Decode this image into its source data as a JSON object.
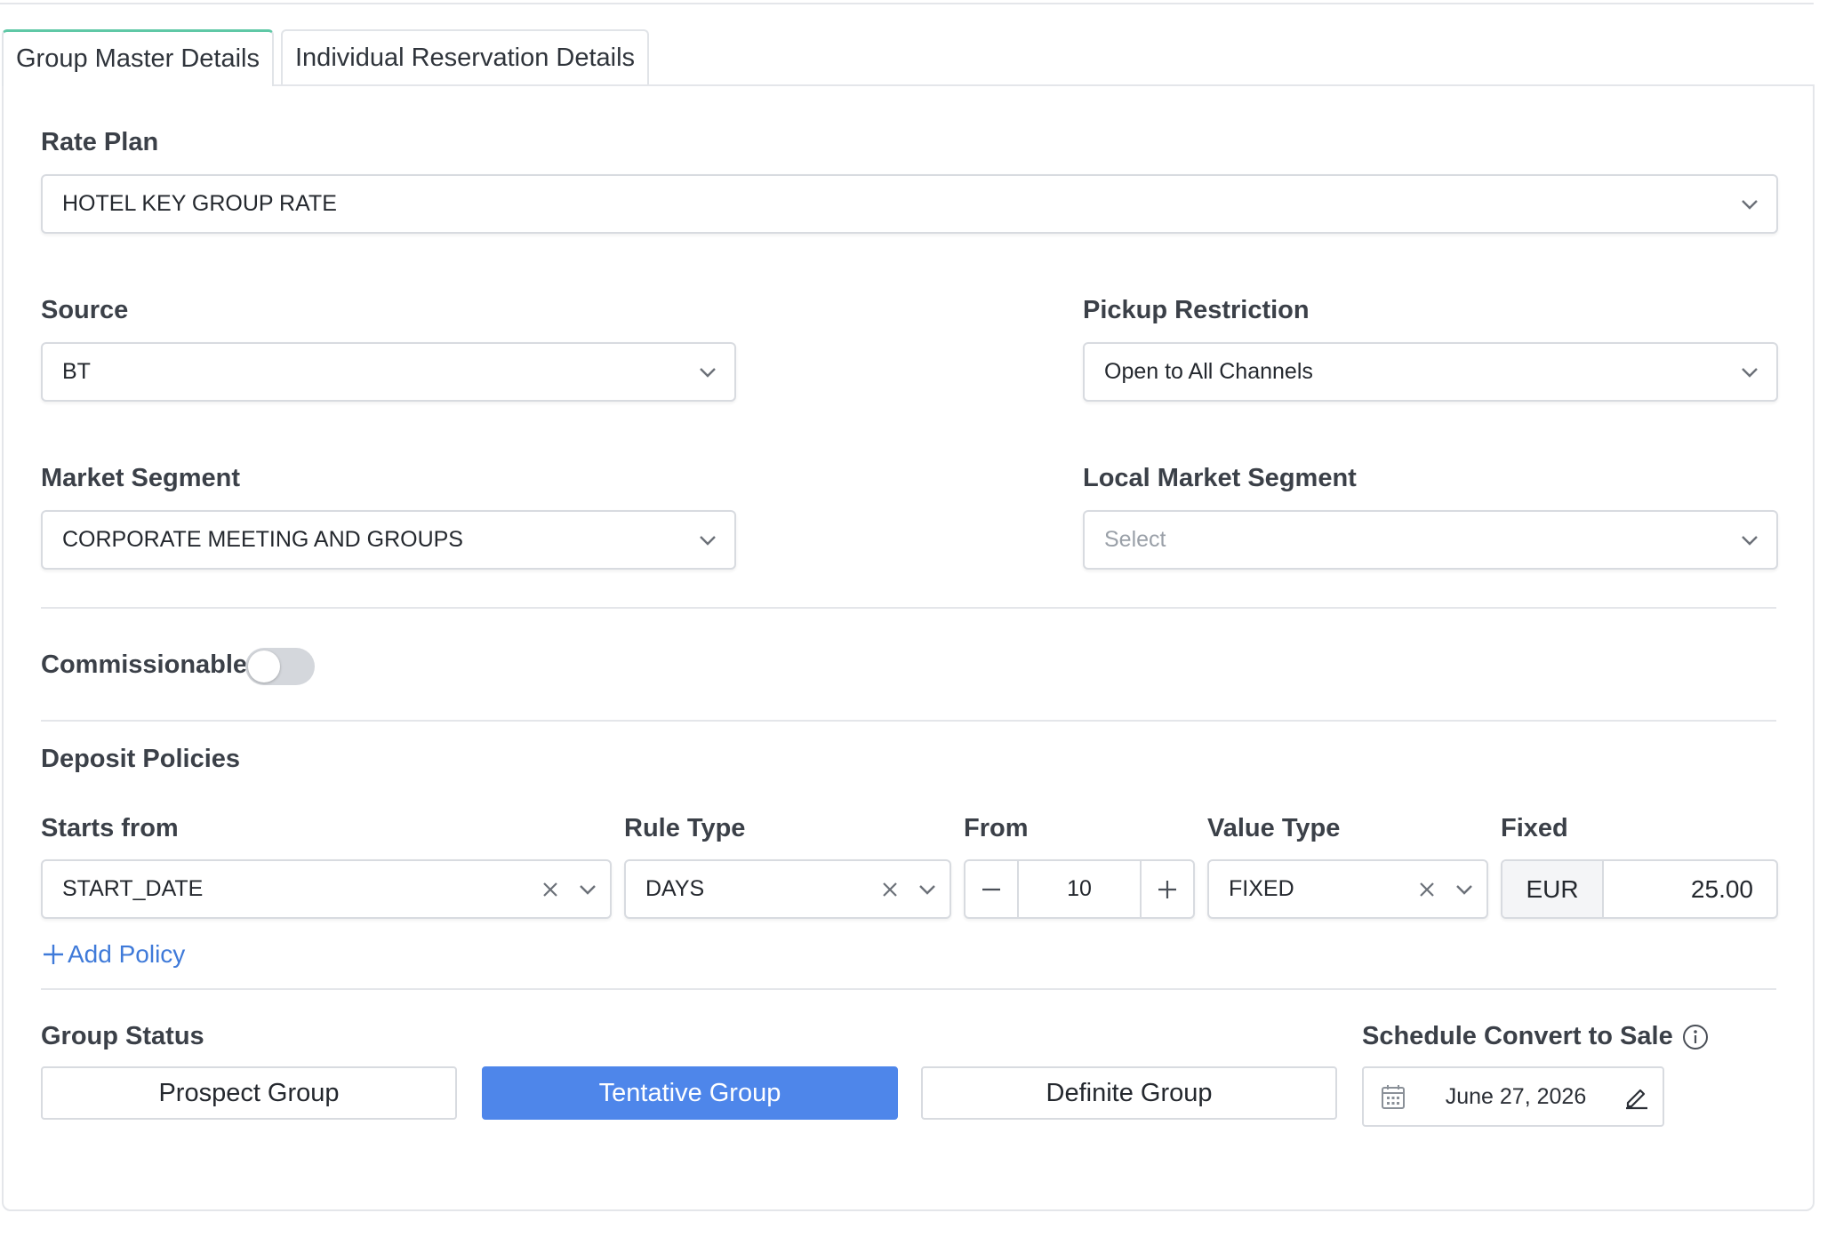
{
  "tabs": [
    {
      "label": "Group Master Details",
      "active": true
    },
    {
      "label": "Individual Reservation Details",
      "active": false
    }
  ],
  "rate_plan": {
    "label": "Rate Plan",
    "value": "HOTEL KEY GROUP RATE"
  },
  "source": {
    "label": "Source",
    "value": "BT"
  },
  "pickup_restriction": {
    "label": "Pickup Restriction",
    "value": "Open to All Channels"
  },
  "market_segment": {
    "label": "Market Segment",
    "value": "CORPORATE MEETING AND GROUPS"
  },
  "local_market_segment": {
    "label": "Local Market Segment",
    "placeholder": "Select"
  },
  "commissionable": {
    "label": "Commissionable",
    "enabled": false
  },
  "deposit_policies": {
    "title": "Deposit Policies",
    "columns": {
      "starts_from": "Starts from",
      "rule_type": "Rule Type",
      "from": "From",
      "value_type": "Value Type",
      "fixed": "Fixed"
    },
    "row": {
      "starts_from": "START_DATE",
      "rule_type": "DAYS",
      "from": "10",
      "value_type": "FIXED",
      "currency": "EUR",
      "amount": "25.00"
    },
    "add_label": "Add Policy"
  },
  "group_status": {
    "label": "Group Status",
    "options": [
      "Prospect Group",
      "Tentative Group",
      "Definite Group"
    ],
    "selected": "Tentative Group"
  },
  "schedule_convert": {
    "label": "Schedule Convert to Sale",
    "date": "June 27, 2026"
  },
  "colors": {
    "accent": "#4e86ea",
    "tab_active": "#5fc8a6",
    "link": "#3f7ad9"
  }
}
